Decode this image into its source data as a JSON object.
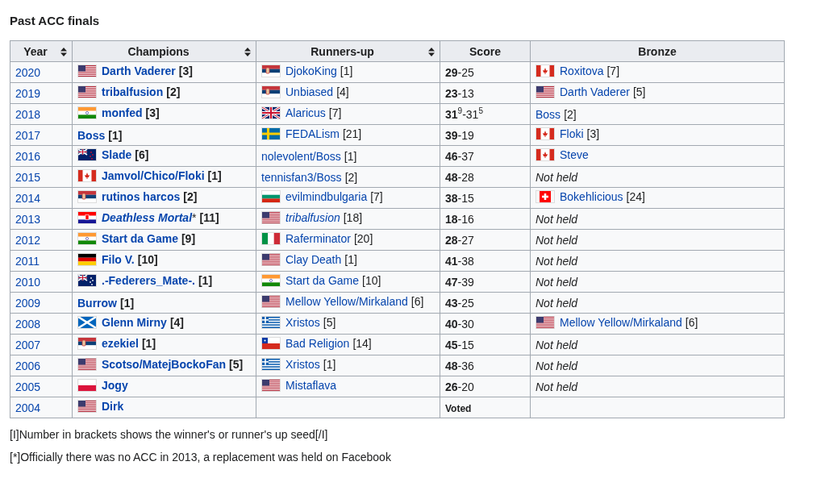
{
  "title": "Past ACC finals",
  "columns": [
    {
      "label": "Year",
      "sortable": true
    },
    {
      "label": "Champions",
      "sortable": true
    },
    {
      "label": "Runners-up",
      "sortable": true
    },
    {
      "label": "Score",
      "sortable": false
    },
    {
      "label": "Bronze",
      "sortable": false
    }
  ],
  "rows": [
    {
      "year": "2020",
      "champion": {
        "flag": {
          "kind": "usa"
        },
        "name": "Darth Vaderer",
        "seed": "[3]",
        "italic": false
      },
      "runner_up": {
        "flag": {
          "kind": "serbia"
        },
        "name": "DjokoKing",
        "seed": "[1]",
        "italic": false
      },
      "score": {
        "kind": "result",
        "text": "**29**-25"
      },
      "bronze": {
        "kind": "player",
        "flag": {
          "kind": "canada"
        },
        "name": "Roxitova",
        "seed": "[7]",
        "italic": false
      }
    },
    {
      "year": "2019",
      "champion": {
        "flag": {
          "kind": "usa"
        },
        "name": "tribalfusion",
        "seed": "[2]",
        "italic": false
      },
      "runner_up": {
        "flag": {
          "kind": "serbia"
        },
        "name": "Unbiased",
        "seed": "[4]",
        "italic": false
      },
      "score": {
        "kind": "result",
        "text": "**23**-13"
      },
      "bronze": {
        "kind": "player",
        "flag": {
          "kind": "usa"
        },
        "name": "Darth Vaderer",
        "seed": "[5]",
        "italic": false
      }
    },
    {
      "year": "2018",
      "champion": {
        "flag": {
          "kind": "india"
        },
        "name": "monfed",
        "seed": "[3]",
        "italic": false
      },
      "runner_up": {
        "flag": {
          "kind": "uk"
        },
        "name": "Alaricus",
        "seed": "[7]",
        "italic": false
      },
      "score": {
        "kind": "result",
        "text": "**31**$^{9}$-31$^{5}$"
      },
      "bronze": {
        "kind": "player",
        "name": "Boss",
        "seed": "[2]",
        "italic": false
      }
    },
    {
      "year": "2017",
      "champion": {
        "name": "Boss",
        "seed": "[1]",
        "italic": false
      },
      "runner_up": {
        "flag": {
          "kind": "sweden"
        },
        "name": "FEDALism",
        "seed": "[21]",
        "italic": false
      },
      "score": {
        "kind": "result",
        "text": "**39**-19"
      },
      "bronze": {
        "kind": "player",
        "flag": {
          "kind": "canada"
        },
        "name": "Floki",
        "seed": "[3]",
        "italic": false
      }
    },
    {
      "year": "2016",
      "champion": {
        "flag": {
          "kind": "new_zealand"
        },
        "name": "Slade",
        "seed": "[6]",
        "italic": false
      },
      "runner_up": {
        "name": "nolevolent/Boss",
        "seed": "[1]",
        "italic": false
      },
      "score": {
        "kind": "result",
        "text": "**46**-37"
      },
      "bronze": {
        "kind": "player",
        "flag": {
          "kind": "canada"
        },
        "name": "Steve",
        "italic": false
      }
    },
    {
      "year": "2015",
      "champion": {
        "flag": {
          "kind": "canada"
        },
        "name": "Jamvol/Chico/Floki",
        "seed": "[1]",
        "italic": false
      },
      "runner_up": {
        "name": "tennisfan3/Boss",
        "seed": "[2]",
        "italic": false
      },
      "score": {
        "kind": "result",
        "text": "**48**-28"
      },
      "bronze": {
        "kind": "not_held",
        "text": "Not held"
      }
    },
    {
      "year": "2014",
      "champion": {
        "flag": {
          "kind": "serbia"
        },
        "name": "rutinos harcos",
        "seed": "[2]",
        "italic": false
      },
      "runner_up": {
        "flag": {
          "kind": "bulgaria"
        },
        "name": "evilmindbulgaria",
        "seed": "[7]",
        "italic": false
      },
      "score": {
        "kind": "result",
        "text": "**38**-15"
      },
      "bronze": {
        "kind": "player",
        "flag": {
          "kind": "switzerland"
        },
        "name": "Bokehlicious",
        "seed": "[24]",
        "italic": false
      }
    },
    {
      "year": "2013",
      "champion": {
        "flag": {
          "kind": "croatia"
        },
        "name": "Deathless Mortal",
        "note": "*",
        "seed": "[11]",
        "italic": true
      },
      "runner_up": {
        "flag": {
          "kind": "usa"
        },
        "name": "tribalfusion",
        "seed": "[18]",
        "italic": true
      },
      "score": {
        "kind": "result",
        "text": "**18**-16"
      },
      "bronze": {
        "kind": "not_held",
        "text": "Not held"
      }
    },
    {
      "year": "2012",
      "champion": {
        "flag": {
          "kind": "india"
        },
        "name": "Start da Game",
        "seed": "[9]",
        "italic": false
      },
      "runner_up": {
        "flag": {
          "kind": "italy"
        },
        "name": "Raferminator",
        "seed": "[20]",
        "italic": false
      },
      "score": {
        "kind": "result",
        "text": "**28**-27"
      },
      "bronze": {
        "kind": "not_held",
        "text": "Not held"
      }
    },
    {
      "year": "2011",
      "champion": {
        "flag": {
          "kind": "germany"
        },
        "name": "Filo V.",
        "seed": "[10]",
        "italic": false
      },
      "runner_up": {
        "flag": {
          "kind": "usa"
        },
        "name": "Clay Death",
        "seed": "[1]",
        "italic": false
      },
      "score": {
        "kind": "result",
        "text": "**41**-38"
      },
      "bronze": {
        "kind": "not_held",
        "text": "Not held"
      }
    },
    {
      "year": "2010",
      "champion": {
        "flag": {
          "kind": "australia"
        },
        "name": ".-Federers_Mate-.",
        "seed": "[1]",
        "italic": false
      },
      "runner_up": {
        "flag": {
          "kind": "india"
        },
        "name": "Start da Game",
        "seed": "[10]",
        "italic": false
      },
      "score": {
        "kind": "result",
        "text": "**47**-39"
      },
      "bronze": {
        "kind": "not_held",
        "text": "Not held"
      }
    },
    {
      "year": "2009",
      "champion": {
        "name": "Burrow",
        "seed": "[1]",
        "italic": false
      },
      "runner_up": {
        "flag": {
          "kind": "usa"
        },
        "name": "Mellow Yellow/Mirkaland",
        "seed": "[6]",
        "italic": false
      },
      "score": {
        "kind": "result",
        "text": "**43**-25"
      },
      "bronze": {
        "kind": "not_held",
        "text": "Not held"
      }
    },
    {
      "year": "2008",
      "champion": {
        "flag": {
          "kind": "scotland"
        },
        "name": "Glenn Mirny",
        "seed": "[4]",
        "italic": false
      },
      "runner_up": {
        "flag": {
          "kind": "greece"
        },
        "name": "Xristos",
        "seed": "[5]",
        "italic": false
      },
      "score": {
        "kind": "result",
        "text": "**40**-30"
      },
      "bronze": {
        "kind": "player",
        "flag": {
          "kind": "usa"
        },
        "name": "Mellow Yellow/Mirkaland",
        "seed": "[6]",
        "italic": false
      }
    },
    {
      "year": "2007",
      "champion": {
        "flag": {
          "kind": "serbia"
        },
        "name": "ezekiel",
        "seed": "[1]",
        "italic": false
      },
      "runner_up": {
        "flag": {
          "kind": "chile"
        },
        "name": "Bad Religion",
        "seed": "[14]",
        "italic": false
      },
      "score": {
        "kind": "result",
        "text": "**45**-15"
      },
      "bronze": {
        "kind": "not_held",
        "text": "Not held"
      }
    },
    {
      "year": "2006",
      "champion": {
        "flag": {
          "kind": "usa"
        },
        "name": "Scotso/MatejBockoFan",
        "seed": "[5]",
        "italic": false
      },
      "runner_up": {
        "flag": {
          "kind": "greece"
        },
        "name": "Xristos",
        "seed": "[1]",
        "italic": false
      },
      "score": {
        "kind": "result",
        "text": "**48**-36"
      },
      "bronze": {
        "kind": "not_held",
        "text": "Not held"
      }
    },
    {
      "year": "2005",
      "champion": {
        "flag": {
          "kind": "poland"
        },
        "name": "Jogy",
        "italic": false
      },
      "runner_up": {
        "flag": {
          "kind": "usa"
        },
        "name": "Mistaflava",
        "italic": false
      },
      "score": {
        "kind": "result",
        "text": "**26**-20"
      },
      "bronze": {
        "kind": "not_held",
        "text": "Not held"
      }
    },
    {
      "year": "2004",
      "champion": {
        "flag": {
          "kind": "usa"
        },
        "name": "Dirk",
        "italic": false
      },
      "score": {
        "kind": "voted",
        "text": "Voted"
      }
    }
  ],
  "footnotes": [
    "[I]Number in brackets shows the winner's or runner's up seed[/I]",
    "[*]Officially there was no ACC in 2013, a replacement was held on Facebook"
  ]
}
